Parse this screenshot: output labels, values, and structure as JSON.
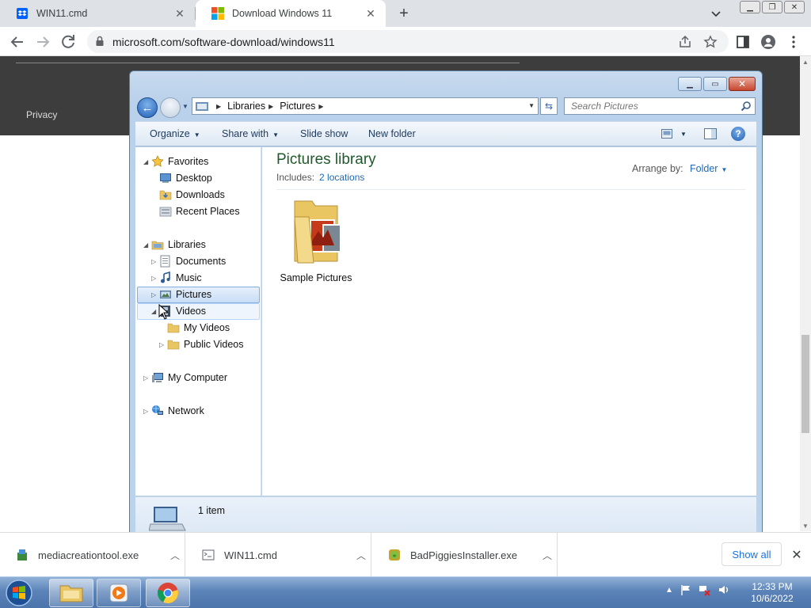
{
  "browser": {
    "tabs": [
      {
        "title": "WIN11.cmd"
      },
      {
        "title": "Download Windows 11"
      }
    ],
    "url": "microsoft.com/software-download/windows11"
  },
  "webpage": {
    "privacy": "Privacy"
  },
  "explorer": {
    "breadcrumb": [
      "Libraries",
      "Pictures"
    ],
    "search_placeholder": "Search Pictures",
    "commands": {
      "organize": "Organize",
      "share_with": "Share with",
      "slide_show": "Slide show",
      "new_folder": "New folder"
    },
    "nav": {
      "favorites": "Favorites",
      "desktop": "Desktop",
      "downloads": "Downloads",
      "recent_places": "Recent Places",
      "libraries": "Libraries",
      "documents": "Documents",
      "music": "Music",
      "pictures": "Pictures",
      "videos": "Videos",
      "my_videos": "My Videos",
      "public_videos": "Public Videos",
      "my_computer": "My Computer",
      "network": "Network"
    },
    "library_title": "Pictures library",
    "includes_label": "Includes:",
    "includes_link": "2 locations",
    "arrange_label": "Arrange by:",
    "arrange_value": "Folder",
    "items": [
      {
        "label": "Sample Pictures"
      }
    ],
    "status_count": "1 item"
  },
  "downloads": {
    "items": [
      {
        "name": "mediacreationtool.exe"
      },
      {
        "name": "WIN11.cmd"
      },
      {
        "name": "BadPiggiesInstaller.exe"
      }
    ],
    "show_all": "Show all"
  },
  "taskbar": {
    "time": "12:33 PM",
    "date": "10/6/2022"
  }
}
